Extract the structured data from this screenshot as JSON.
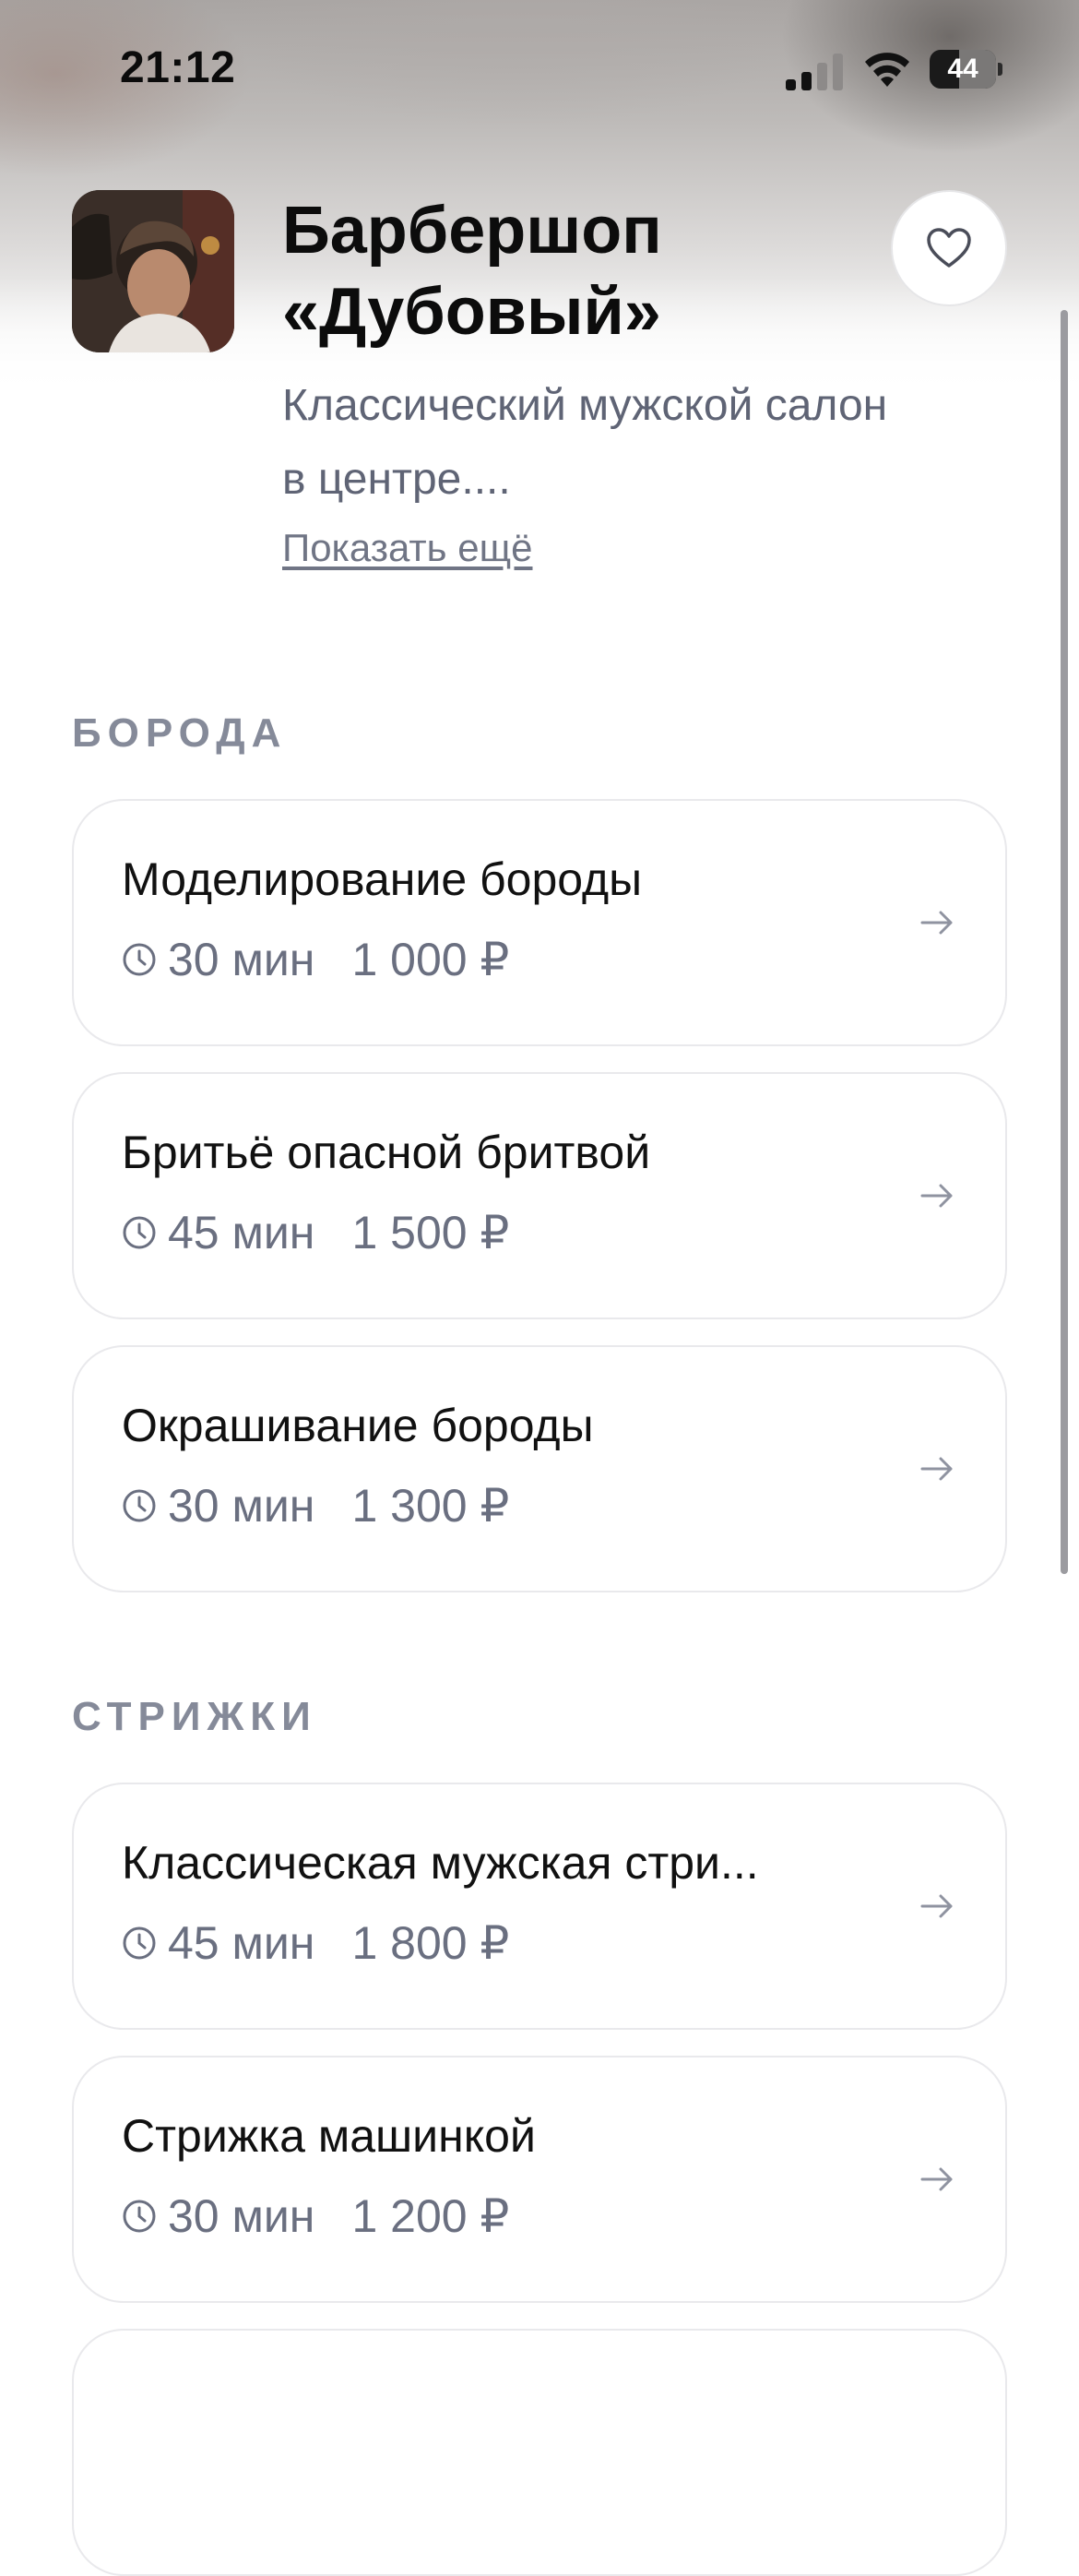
{
  "status_bar": {
    "time": "21:12",
    "battery_level": "44",
    "battery_fraction": 0.44,
    "icons": [
      "signal-icon",
      "wifi-icon",
      "battery-icon"
    ]
  },
  "salon": {
    "name": "Барбершоп «Дубовый»",
    "description": "Классический мужской салон в центре....",
    "show_more_label": "Показать ещё",
    "favorite_icon": "heart-icon"
  },
  "sections": [
    {
      "title": "БОРОДА",
      "services": [
        {
          "name": "Моделирование бороды",
          "duration": "30 мин",
          "price": "1 000 ₽"
        },
        {
          "name": "Бритьё опасной бритвой",
          "duration": "45 мин",
          "price": "1 500 ₽"
        },
        {
          "name": "Окрашивание бороды",
          "duration": "30 мин",
          "price": "1 300 ₽"
        }
      ]
    },
    {
      "title": "СТРИЖКИ",
      "services": [
        {
          "name": "Классическая мужская стри...",
          "duration": "45 мин",
          "price": "1 800 ₽"
        },
        {
          "name": "Стрижка машинкой",
          "duration": "30 мин",
          "price": "1 200 ₽"
        }
      ]
    }
  ],
  "colors": {
    "text_primary": "#111111",
    "text_secondary": "#6a6f80",
    "section_title": "#858a99",
    "card_border": "#e9e9ec"
  }
}
